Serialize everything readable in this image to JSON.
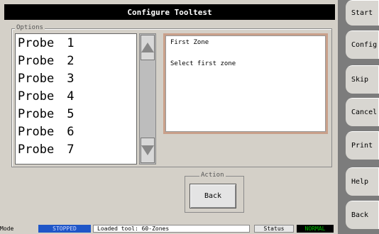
{
  "title": "Configure Tooltest",
  "options": {
    "caption": "Options",
    "probes": [
      {
        "label": "Probe",
        "num": "1"
      },
      {
        "label": "Probe",
        "num": "2"
      },
      {
        "label": "Probe",
        "num": "3"
      },
      {
        "label": "Probe",
        "num": "4"
      },
      {
        "label": "Probe",
        "num": "5"
      },
      {
        "label": "Probe",
        "num": "6"
      },
      {
        "label": "Probe",
        "num": "7"
      }
    ]
  },
  "info": {
    "title": "First Zone",
    "message": "Select first zone"
  },
  "action": {
    "caption": "Action",
    "back_label": "Back"
  },
  "status": {
    "mode_label": "Mode",
    "mode_value": "STOPPED",
    "message": "Loaded tool: 60-Zones",
    "status_label": "Status",
    "status_value": "NORMAL"
  },
  "sidebar": {
    "buttons": [
      "Start",
      "Config",
      "Skip",
      "Cancel",
      "Print",
      "Help",
      "Back"
    ]
  },
  "colors": {
    "titlebar": "#000000",
    "mode_badge": "#1f56c8",
    "status_ok": "#00c000",
    "panel_border": "#c9a08a"
  }
}
